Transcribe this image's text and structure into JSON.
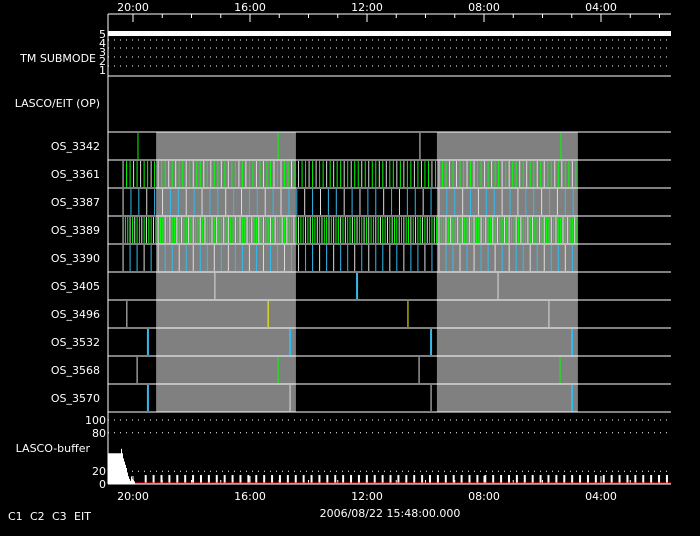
{
  "chart_data": {
    "type": "timeline",
    "title": "",
    "time_labels": [
      "20:00",
      "16:00",
      "12:00",
      "08:00",
      "04:00"
    ],
    "xlabel": "2006/08/22 15:48:00.000",
    "tm_submode": {
      "label": "TM SUBMODE",
      "ticks": [
        "5",
        "4",
        "3",
        "2",
        "1"
      ],
      "value": 5
    },
    "lasco_eit_label": "LASCO/EIT (OP)",
    "shaded_hours": [
      [
        0.79,
        5.57
      ],
      [
        10.39,
        15.21
      ]
    ],
    "rows": [
      {
        "name": "OS_3342",
        "events": [
          {
            "t": 0.17,
            "c": "C2"
          },
          {
            "t": 4.96,
            "c": "C2"
          },
          {
            "t": 9.81,
            "c": "W"
          },
          {
            "t": 14.63,
            "c": "C2"
          }
        ]
      },
      {
        "name": "OS_3361",
        "dense": "C2",
        "period_h": 0.12
      },
      {
        "name": "OS_3387",
        "dense": "C3",
        "period_h": 0.27
      },
      {
        "name": "OS_3389",
        "dense": "C2",
        "period_h": 0.08
      },
      {
        "name": "OS_3390",
        "dense": "C3",
        "period_h": 0.24
      },
      {
        "name": "OS_3405",
        "events": [
          {
            "t": 2.8,
            "c": "W"
          },
          {
            "t": 7.66,
            "c": "C3"
          },
          {
            "t": 12.48,
            "c": "W"
          }
        ]
      },
      {
        "name": "OS_3496",
        "events": [
          {
            "t": -0.21,
            "c": "W"
          },
          {
            "t": 4.62,
            "c": "EIT"
          },
          {
            "t": 9.4,
            "c": "EIT"
          },
          {
            "t": 14.22,
            "c": "W"
          }
        ]
      },
      {
        "name": "OS_3532",
        "events": [
          {
            "t": 0.51,
            "c": "C3"
          },
          {
            "t": 5.37,
            "c": "C3"
          },
          {
            "t": 10.19,
            "c": "C3"
          },
          {
            "t": 15.01,
            "c": "C3"
          }
        ]
      },
      {
        "name": "OS_3568",
        "events": [
          {
            "t": 0.14,
            "c": "W"
          },
          {
            "t": 4.96,
            "c": "C2"
          },
          {
            "t": 9.78,
            "c": "W"
          },
          {
            "t": 14.6,
            "c": "C2"
          }
        ]
      },
      {
        "name": "OS_3570",
        "events": [
          {
            "t": 0.51,
            "c": "C3"
          },
          {
            "t": 5.37,
            "c": "W"
          },
          {
            "t": 10.19,
            "c": "W"
          },
          {
            "t": 15.01,
            "c": "C3"
          }
        ]
      }
    ],
    "buffer": {
      "label": "LASCO-buffer",
      "yticks": [
        "100",
        "80",
        "20",
        "0"
      ],
      "ylim": [
        0,
        100
      ],
      "initial": [
        48,
        48,
        48,
        48,
        48,
        48,
        48,
        48,
        48,
        48,
        48,
        48,
        48,
        55,
        48,
        40,
        35,
        30,
        25,
        18,
        12,
        8,
        5,
        12,
        8,
        6,
        4
      ],
      "spike_value": 14,
      "spike_period_h": 0.27
    },
    "legend": [
      {
        "label": "C1",
        "color": "#ff0000"
      },
      {
        "label": "C2",
        "color": "#00ff00"
      },
      {
        "label": "C3",
        "color": "#88ddff"
      },
      {
        "label": "EIT",
        "color": "#ffff00"
      }
    ]
  }
}
